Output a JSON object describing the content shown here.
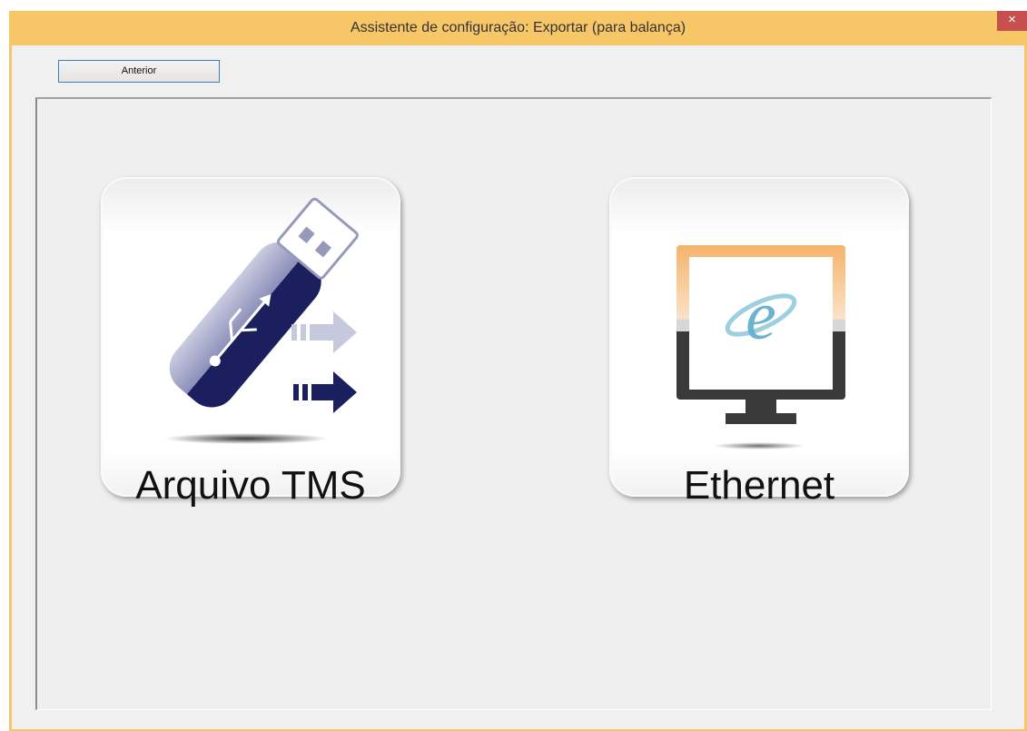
{
  "window": {
    "title": "Assistente de configuração: Exportar (para balança)",
    "close_glyph": "×"
  },
  "toolbar": {
    "back_label": "Anterior"
  },
  "options": [
    {
      "label": "Arquivo TMS",
      "icon": "usb-drive-export-icon"
    },
    {
      "label": "Ethernet",
      "icon": "monitor-internet-icon"
    }
  ],
  "colors": {
    "frame": "#f6c667",
    "close": "#c7504f",
    "usb_navy": "#1c1f5e",
    "monitor_orange": "#f5b36a",
    "monitor_dark": "#3a3a3a"
  }
}
